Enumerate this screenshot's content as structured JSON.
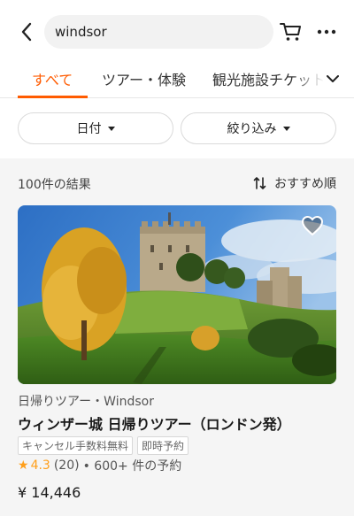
{
  "header": {
    "search_value": "windsor",
    "back_icon": "chevron-left-icon",
    "cart_icon": "cart-icon",
    "more_icon": "more-dots-icon"
  },
  "tabs": [
    {
      "label": "すべて",
      "active": true
    },
    {
      "label": "ツアー・体験",
      "active": false
    },
    {
      "label": "観光施設チケット",
      "active": false
    }
  ],
  "filters": {
    "date_label": "日付",
    "refine_label": "絞り込み"
  },
  "results": {
    "count_label": "100件の結果",
    "sort_label": "おすすめ順"
  },
  "card": {
    "category": "日帰りツアー・Windsor",
    "title": "ウィンザー城 日帰りツアー（ロンドン発）",
    "tags": [
      "キャンセル手数料無料",
      "即時予約"
    ],
    "rating": "4.3",
    "reviews": "(20)",
    "bookings": "• 600+ 件の予約",
    "price": "¥ 14,446"
  },
  "colors": {
    "accent": "#ff5b00",
    "star": "#ff9f1a"
  }
}
